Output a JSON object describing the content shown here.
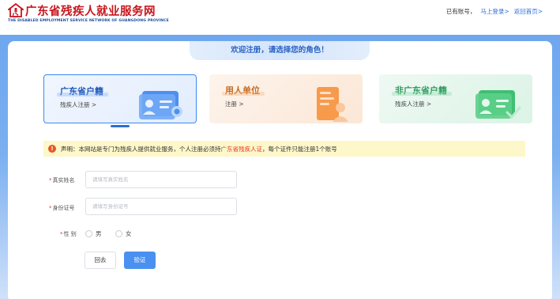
{
  "header": {
    "logo_icon": "disability-house-logo",
    "site_title": "广东省残疾人就业服务网",
    "site_subtitle": "THE DISABLED EMPLOYMENT SERVICE NETWORK OF GUANGDONG PROVINCE",
    "account_prompt": "已有账号，",
    "login_link": "马上登录>",
    "home_link": "返回首页>"
  },
  "welcome": "欢迎注册，请选择您的角色！",
  "roles": [
    {
      "title": "广东省户籍",
      "subtitle": "残疾人注册 >",
      "active": true,
      "icon": "id-card-badge-icon"
    },
    {
      "title": "用人单位",
      "subtitle": "注册 >",
      "active": false,
      "icon": "document-user-icon"
    },
    {
      "title": "非广东省户籍",
      "subtitle": "残疾人注册 >",
      "active": false,
      "icon": "id-card-check-icon"
    }
  ],
  "notice": {
    "icon_text": "!",
    "prefix": "声明：本网站是专门为残疾人提供就业服务，个人注册必须持",
    "highlight": "广东省残疾人证",
    "suffix": "，每个证件只能注册1个账号"
  },
  "form": {
    "name_label": "真实姓名",
    "name_placeholder": "请填写真实姓名",
    "id_label": "身份证号",
    "id_placeholder": "请填写身份证号",
    "gender_label": "性 别",
    "gender_options": [
      "男",
      "女"
    ],
    "required_mark": "*",
    "back_button": "回去",
    "verify_button": "验证"
  },
  "colors": {
    "brand_red": "#c8161d",
    "primary_blue": "#4a90f0",
    "notice_bg": "#fdf7c9"
  }
}
